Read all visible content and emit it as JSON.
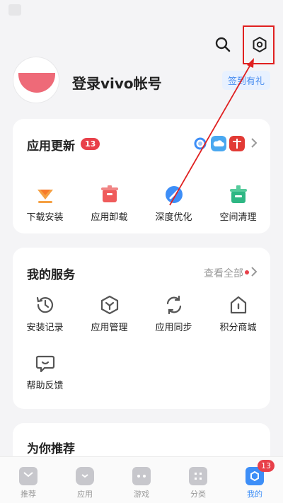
{
  "header": {
    "login_text": "登录vivo帐号",
    "signin_badge": "签到有礼"
  },
  "app_update": {
    "title": "应用更新",
    "badge": "13",
    "actions": [
      {
        "label": "下载安装",
        "icon": "download-icon"
      },
      {
        "label": "应用卸载",
        "icon": "trash-icon"
      },
      {
        "label": "深度优化",
        "icon": "optimize-icon"
      },
      {
        "label": "空间清理",
        "icon": "broom-icon"
      }
    ]
  },
  "services": {
    "title": "我的服务",
    "see_all": "查看全部",
    "items": [
      {
        "label": "安装记录",
        "icon": "history-icon"
      },
      {
        "label": "应用管理",
        "icon": "app-manage-icon"
      },
      {
        "label": "应用同步",
        "icon": "sync-icon"
      },
      {
        "label": "积分商城",
        "icon": "store-icon"
      },
      {
        "label": "帮助反馈",
        "icon": "feedback-icon"
      }
    ]
  },
  "recommend": {
    "title": "为你推荐"
  },
  "tabbar": {
    "tabs": [
      {
        "label": "推荐",
        "icon": "recommend-icon"
      },
      {
        "label": "应用",
        "icon": "apps-icon"
      },
      {
        "label": "游戏",
        "icon": "gamepad-icon"
      },
      {
        "label": "分类",
        "icon": "category-icon"
      },
      {
        "label": "我的",
        "icon": "profile-icon"
      }
    ],
    "mine_badge": "13"
  },
  "colors": {
    "accent": "#3d8ef7",
    "badge_red": "#e8404a",
    "annotation_red": "#e02020"
  }
}
